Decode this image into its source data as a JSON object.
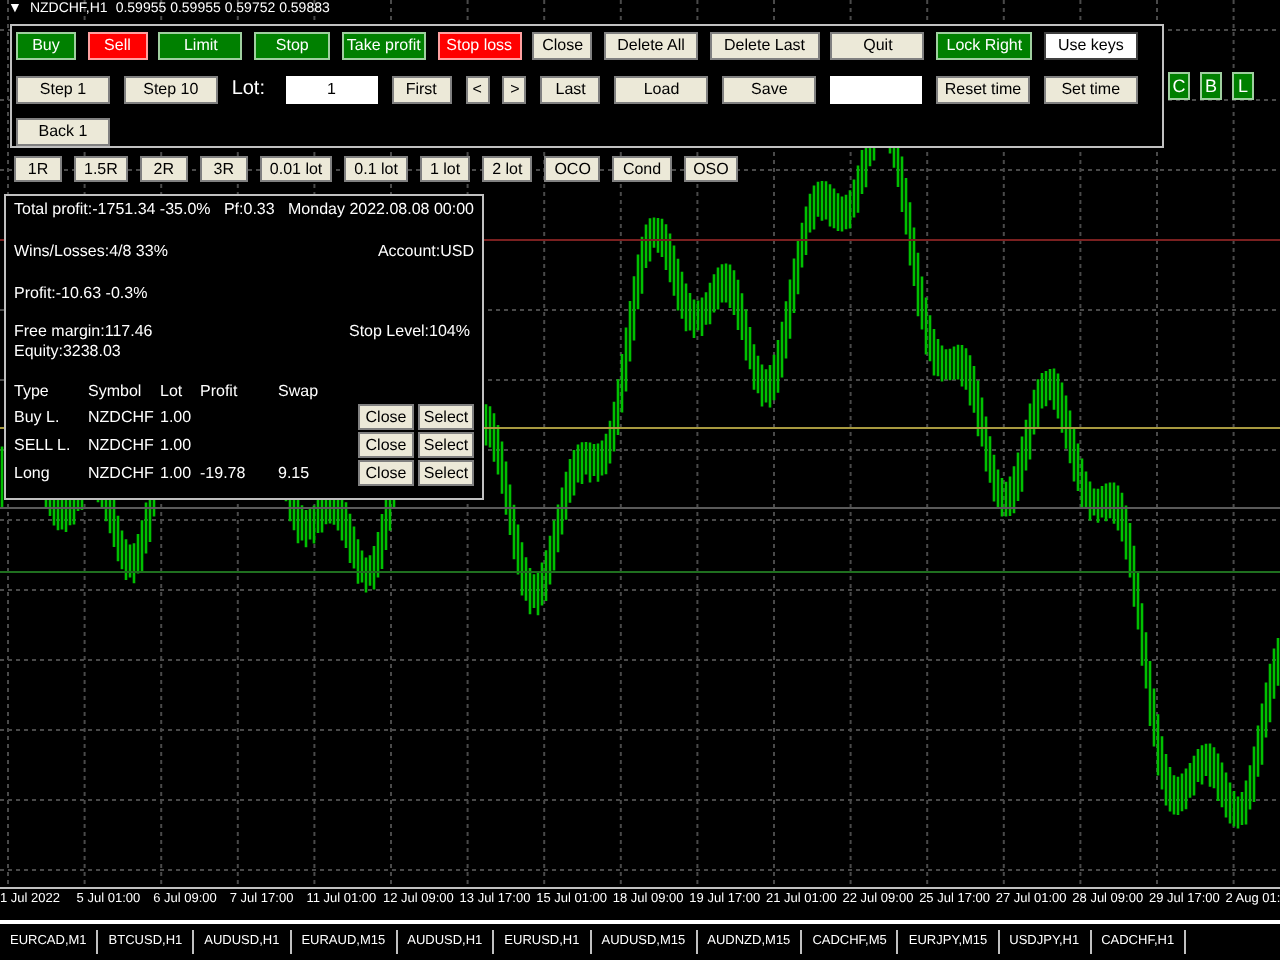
{
  "chart_header": {
    "arrow": "▼",
    "symbol": "NZDCHF,H1",
    "prices": "0.59955 0.59955 0.59752 0.59883"
  },
  "button_rows": [
    [
      {
        "label": "Buy",
        "kind": "green"
      },
      {
        "label": "Sell",
        "kind": "red"
      },
      {
        "label": "Limit",
        "kind": "green"
      },
      {
        "label": "Stop",
        "kind": "green"
      },
      {
        "label": "Take profit",
        "kind": "green"
      },
      {
        "label": "Stop loss",
        "kind": "red"
      },
      {
        "label": "Close",
        "kind": "plain"
      },
      {
        "label": "Delete All",
        "kind": "plain"
      },
      {
        "label": "Delete Last",
        "kind": "plain"
      },
      {
        "label": "Quit",
        "kind": "plain"
      },
      {
        "label": "Lock Right",
        "kind": "green"
      },
      {
        "label": "Use keys",
        "kind": "white"
      }
    ],
    [
      {
        "label": "Step 1",
        "kind": "plain"
      },
      {
        "label": "Step 10",
        "kind": "plain"
      },
      {
        "label": "Lot:",
        "kind": "label"
      },
      {
        "label": "1",
        "kind": "input"
      },
      {
        "label": "First",
        "kind": "plain"
      },
      {
        "label": "<",
        "kind": "plain"
      },
      {
        "label": ">",
        "kind": "plain"
      },
      {
        "label": "Last",
        "kind": "plain"
      },
      {
        "label": "Load",
        "kind": "plain"
      },
      {
        "label": "Save",
        "kind": "plain"
      },
      {
        "kind": "input"
      },
      {
        "label": "Reset time",
        "kind": "plain"
      },
      {
        "label": "Set time",
        "kind": "plain"
      }
    ],
    [
      {
        "label": "Back 1",
        "kind": "plain"
      }
    ]
  ],
  "side_buttons": [
    "C",
    "B",
    "L"
  ],
  "lot_buttons": [
    "1R",
    "1.5R",
    "2R",
    "3R",
    "0.01 lot",
    "0.1 lot",
    "1 lot",
    "2 lot",
    "OCO",
    "Cond",
    "OSO"
  ],
  "info": {
    "total_profit": "Total profit:-1751.34 -35.0%",
    "pf": "Pf:0.33",
    "date": "Monday 2022.08.08 00:00",
    "wins_losses": "Wins/Losses:4/8 33%",
    "account": "Account:USD",
    "profit": "Profit:-10.63 -0.3%",
    "free_margin": "Free margin:117.46",
    "stop_level": "Stop Level:104%",
    "equity": "Equity:3238.03",
    "columns": [
      "Type",
      "Symbol",
      "Lot",
      "Profit",
      "Swap"
    ],
    "rows": [
      {
        "cells": [
          "Buy L.",
          "NZDCHF",
          "1.00",
          "",
          ""
        ],
        "close": "Close",
        "select": "Select"
      },
      {
        "cells": [
          "SELL L.",
          "NZDCHF",
          "1.00",
          "",
          ""
        ],
        "close": "Close",
        "select": "Select"
      },
      {
        "cells": [
          "Long",
          "NZDCHF",
          "1.00",
          "-19.78",
          "9.15"
        ],
        "close": "Close",
        "select": "Select"
      }
    ]
  },
  "time_axis": [
    "1 Jul 2022",
    "5 Jul 01:00",
    "6 Jul 09:00",
    "7 Jul 17:00",
    "11 Jul 01:00",
    "12 Jul 09:00",
    "13 Jul 17:00",
    "15 Jul 01:00",
    "18 Jul 09:00",
    "19 Jul 17:00",
    "21 Jul 01:00",
    "22 Jul 09:00",
    "25 Jul 17:00",
    "27 Jul 01:00",
    "28 Jul 09:00",
    "29 Jul 17:00",
    "2 Aug 01:"
  ],
  "tabs": [
    "EURCAD,M1",
    "BTCUSD,H1",
    "AUDUSD,H1",
    "EURAUD,M15",
    "AUDUSD,H1",
    "EURUSD,H1",
    "AUDUSD,M15",
    "AUDNZD,M15",
    "CADCHF,M5",
    "EURJPY,M15",
    "USDJPY,H1",
    "CADCHF,H1"
  ]
}
